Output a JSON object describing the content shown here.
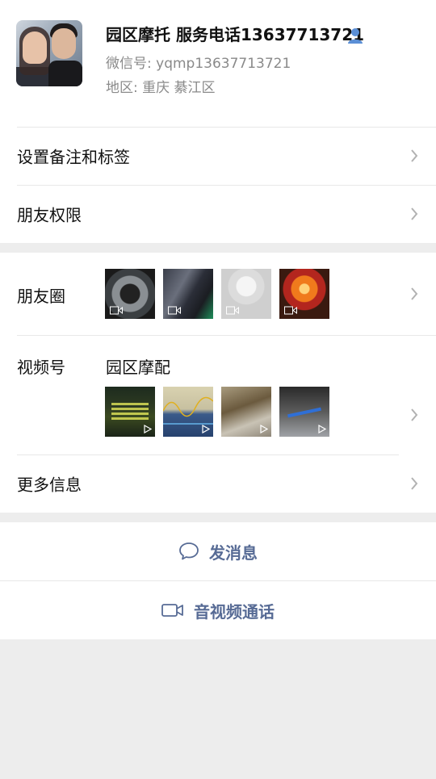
{
  "profile": {
    "name": "园区摩托 服务电话13637713721",
    "wechat_id": "微信号: yqmp13637713721",
    "region": "地区: 重庆  綦江区"
  },
  "menu": {
    "remark_label": "设置备注和标签",
    "permissions_label": "朋友权限",
    "moments_label": "朋友圈",
    "channels_label": "视频号",
    "channels_name": "园区摩配",
    "more_info_label": "更多信息"
  },
  "actions": {
    "message_label": "发消息",
    "call_label": "音视频通话"
  },
  "colors": {
    "link": "#576b95",
    "background": "#ededed"
  }
}
